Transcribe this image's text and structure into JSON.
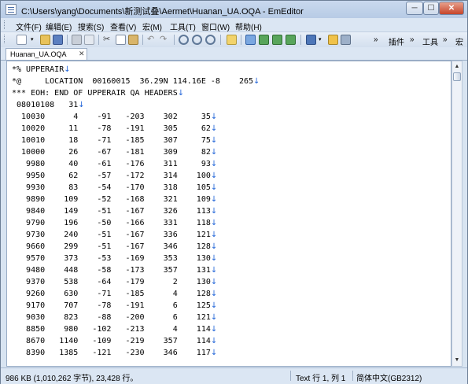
{
  "window": {
    "title": "C:\\Users\\yang\\Documents\\新测试叠\\Aermet\\Huanan_UA.OQA - EmEditor"
  },
  "window_buttons": {
    "minimize": "─",
    "maximize": "☐",
    "close": "✕"
  },
  "menu": [
    "文件(F)",
    "编辑(E)",
    "搜索(S)",
    "查看(V)",
    "宏(M)",
    "工具(T)",
    "窗口(W)",
    "帮助(H)"
  ],
  "toolbar": {
    "more": "»",
    "plugins": "插件",
    "tools": "工具",
    "macro": "宏"
  },
  "tab": {
    "label": "Huanan_UA.OQA",
    "close": "✕"
  },
  "editor": {
    "eol_mark": "↓",
    "lines": [
      "*% UPPERAIR",
      "*@     LOCATION  00160015  36.29N 114.16E -8    265",
      "*** EOH: END OF UPPERAIR QA HEADERS",
      " 08010108   31",
      "  10030      4    -91   -203    302     35",
      "  10020     11    -78   -191    305     62",
      "  10010     18    -71   -185    307     75",
      "  10000     26    -67   -181    309     82",
      "   9980     40    -61   -176    311     93",
      "   9950     62    -57   -172    314    100",
      "   9930     83    -54   -170    318    105",
      "   9890    109    -52   -168    321    109",
      "   9840    149    -51   -167    326    113",
      "   9790    196    -50   -166    331    118",
      "   9730    240    -51   -167    336    121",
      "   9660    299    -51   -167    346    128",
      "   9570    373    -53   -169    353    130",
      "   9480    448    -58   -173    357    131",
      "   9370    538    -64   -179      2    130",
      "   9260    630    -71   -185      4    128",
      "   9170    707    -78   -191      6    125",
      "   9030    823    -88   -200      6    121",
      "   8850    980   -102   -213      4    114",
      "   8670   1140   -109   -219    357    114",
      "   8390   1385   -121   -230    346    117"
    ]
  },
  "statusbar": {
    "size": "986 KB (1,010,262 字节), 23,428 行。",
    "position": "Text  行 1, 列 1",
    "encoding": "简体中文(GB2312)"
  }
}
